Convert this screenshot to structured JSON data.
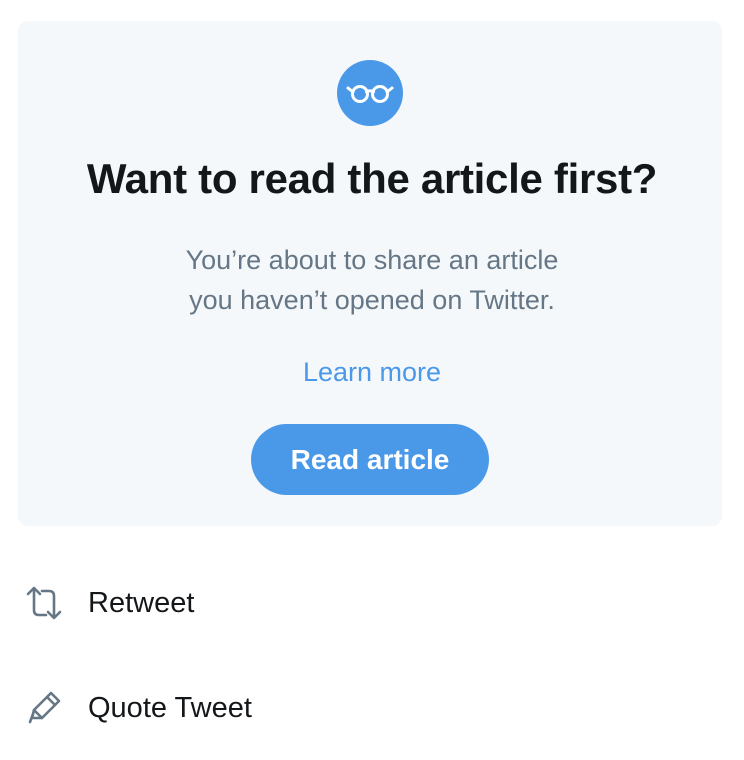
{
  "prompt": {
    "icon": "glasses-icon",
    "title": "Want to read the article first?",
    "body_line_1": "You’re about to share an article",
    "body_line_2": "you haven’t opened on Twitter.",
    "learn_more": "Learn more",
    "read_button": "Read article",
    "accent_color": "#4a99e9",
    "card_background": "#f5f8fa"
  },
  "menu": {
    "items": [
      {
        "label": "Retweet",
        "icon": "retweet-icon"
      },
      {
        "label": "Quote Tweet",
        "icon": "pencil-icon"
      }
    ]
  }
}
